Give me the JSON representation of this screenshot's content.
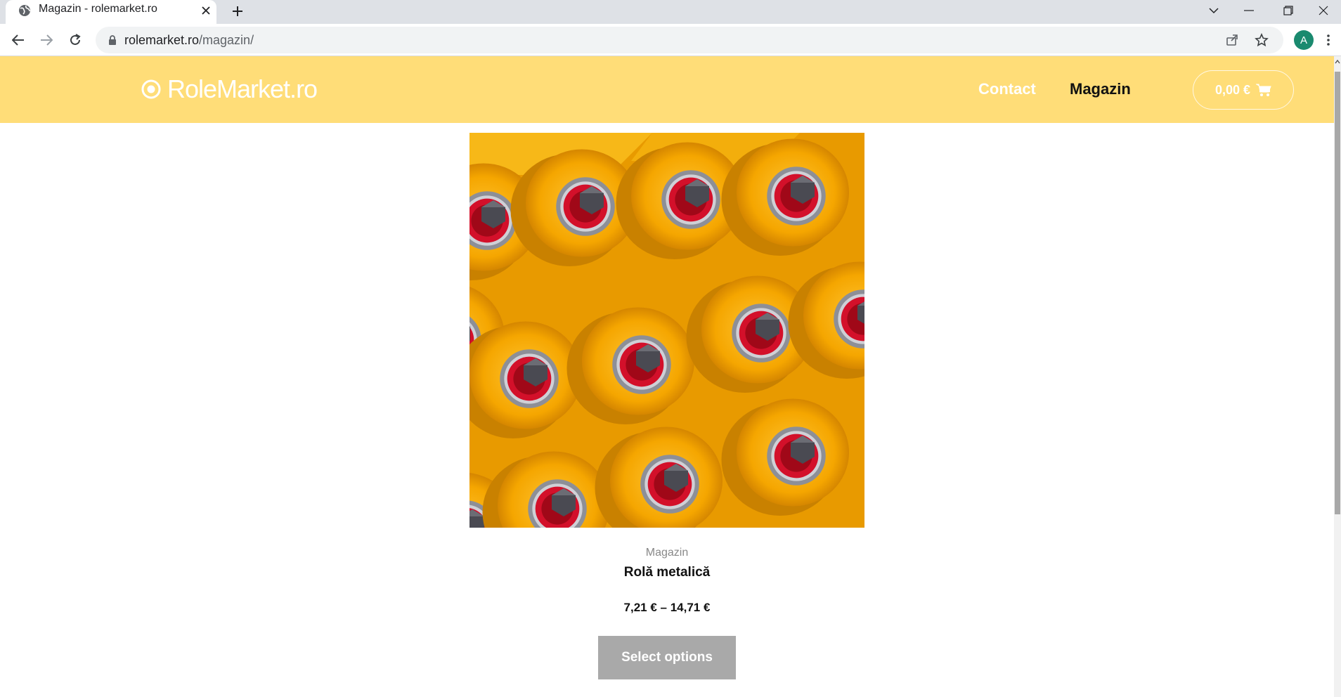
{
  "browser": {
    "tab": {
      "title": "Magazin - rolemarket.ro",
      "favicon": "globe-icon"
    },
    "address_bar": {
      "domain": "rolemarket.ro",
      "path": "/magazin/"
    },
    "profile_initial": "A",
    "profile_color": "#1a8a6f"
  },
  "site": {
    "logo_text": "RoleMarket.ro",
    "nav": {
      "contact": "Contact",
      "magazin": "Magazin"
    },
    "cart_total": "0,00 €",
    "header_color": "#ffdd78"
  },
  "product": {
    "image_icon": "conveyor-rollers-image",
    "category": "Magazin",
    "title": "Rolă metalică",
    "price": "7,21 € – 14,71 €",
    "button_label": "Select options"
  }
}
